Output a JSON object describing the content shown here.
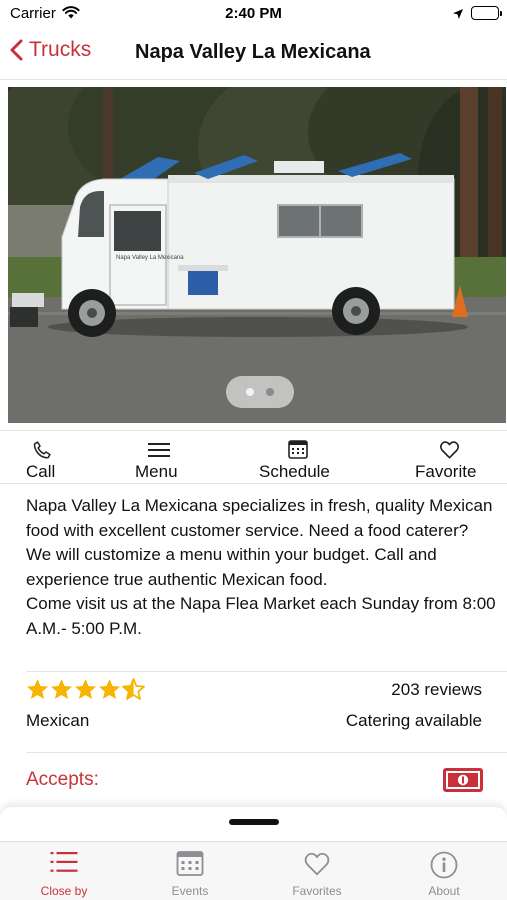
{
  "status_bar": {
    "carrier": "Carrier",
    "time": "2:40 PM"
  },
  "nav": {
    "back_label": "Trucks",
    "title": "Napa Valley La Mexicana"
  },
  "hero": {
    "truck_signage": "Napa Valley La Mexicana",
    "page_count": 2,
    "current_page": 1
  },
  "actions": [
    {
      "label": "Call",
      "icon": "phone-icon"
    },
    {
      "label": "Menu",
      "icon": "menu-lines-icon"
    },
    {
      "label": "Schedule",
      "icon": "calendar-icon"
    },
    {
      "label": "Favorite",
      "icon": "heart-icon"
    }
  ],
  "description": {
    "line1": "Napa Valley La Mexicana specializes in fresh, quality Mexican food with excellent customer service.  Need a food caterer? We will customize a menu within your budget. Call and experience true authentic Mexican food.",
    "line2": "Come visit us at the Napa Flea Market each Sunday from 8:00 A.M.- 5:00 P.M."
  },
  "rating": {
    "stars": 4.5,
    "max_stars": 5,
    "reviews": "203 reviews"
  },
  "info": {
    "cuisine": "Mexican",
    "catering": "Catering available"
  },
  "accepts": {
    "label": "Accepts:",
    "methods": [
      "cash-icon"
    ]
  },
  "tabs": [
    {
      "label": "Close by",
      "icon": "list-icon",
      "active": true
    },
    {
      "label": "Events",
      "icon": "calendar-icon",
      "active": false
    },
    {
      "label": "Favorites",
      "icon": "heart-icon",
      "active": false
    },
    {
      "label": "About",
      "icon": "info-icon",
      "active": false
    }
  ],
  "colors": {
    "accent": "#c8313a",
    "inactive_tab": "#8e8e93",
    "star": "#f6b400"
  }
}
